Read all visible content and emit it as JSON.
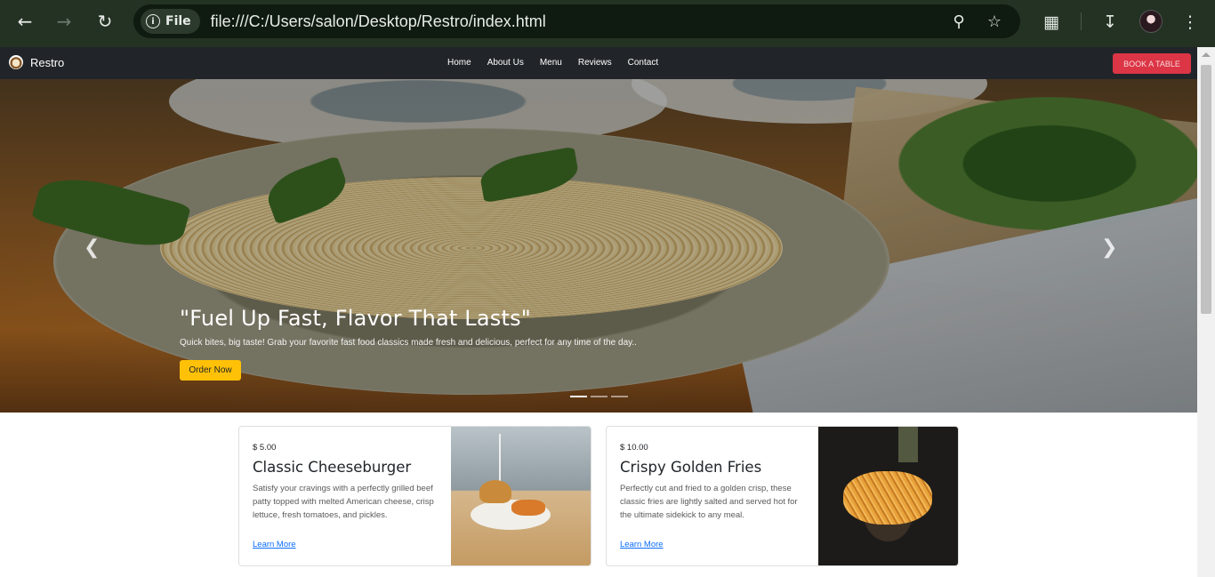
{
  "browser": {
    "chip_label": "File",
    "url": "file:///C:/Users/salon/Desktop/Restro/index.html"
  },
  "site": {
    "brand": "Restro",
    "nav": [
      "Home",
      "About Us",
      "Menu",
      "Reviews",
      "Contact"
    ],
    "book_label": "BOOK A TABLE"
  },
  "hero": {
    "heading": "\"Fuel Up Fast, Flavor That Lasts\"",
    "subtext": "Quick bites, big taste! Grab your favorite fast food classics made fresh and delicious, perfect for any time of the day..",
    "button": "Order Now",
    "slides": 3,
    "active_slide": 1
  },
  "cards": [
    {
      "price": "$ 5.00",
      "title": "Classic Cheeseburger",
      "description": "Satisfy your cravings with a perfectly grilled beef patty topped with melted American cheese, crisp lettuce, fresh tomatoes, and pickles.",
      "link": "Learn More"
    },
    {
      "price": "$ 10.00",
      "title": "Crispy Golden Fries",
      "description": "Perfectly cut and fried to a golden crisp, these classic fries are lightly salted and served hot for the ultimate sidekick to any meal.",
      "link": "Learn More"
    }
  ],
  "colors": {
    "chrome_bg": "#233223",
    "navbar_bg": "#212529",
    "book_button": "#dc3545",
    "order_button": "#ffc107",
    "link": "#0d6efd"
  }
}
